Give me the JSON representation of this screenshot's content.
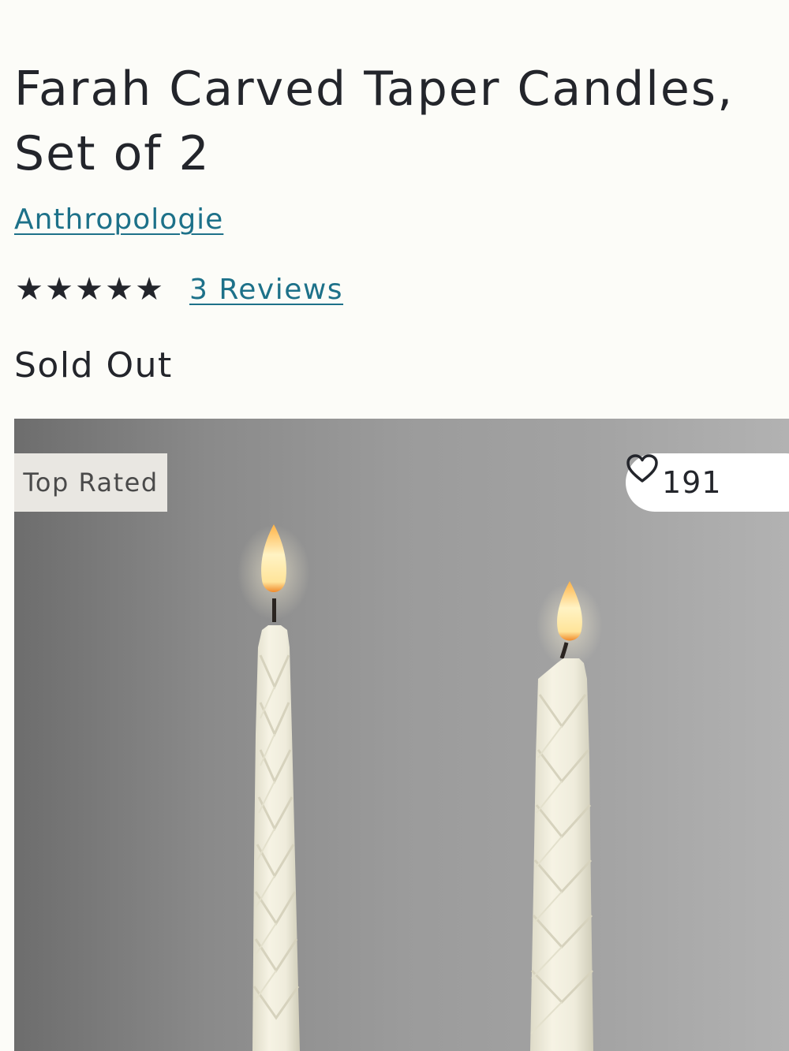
{
  "product": {
    "title": "Farah Carved Taper Candles, Set of 2",
    "brand": "Anthropologie",
    "rating_stars": 5,
    "rating_max": 5,
    "reviews_label": "3 Reviews",
    "status": "Sold Out"
  },
  "media": {
    "badge": "Top Rated",
    "likes": "191",
    "heart_icon": "heart-outline-icon"
  },
  "colors": {
    "text": "#23252b",
    "link": "#1d7189",
    "background": "#fcfcf8",
    "badge_bg": "#e9e7e2"
  }
}
